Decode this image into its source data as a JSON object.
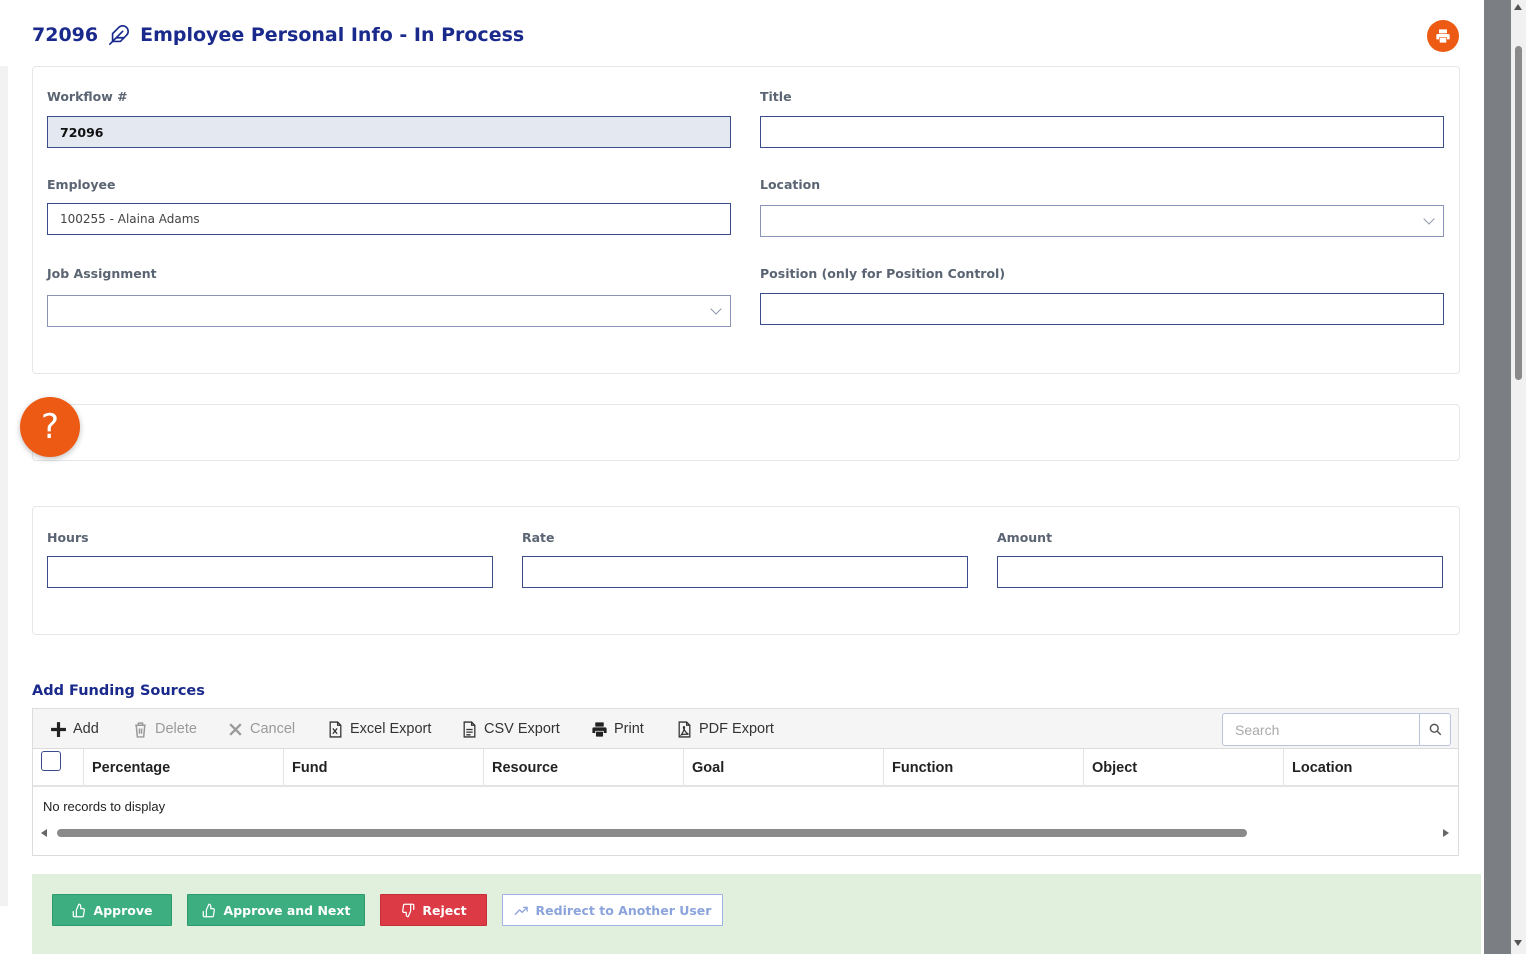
{
  "header": {
    "workflow_number": "72096",
    "title": "Employee Personal Info - In Process"
  },
  "form": {
    "workflow_label": "Workflow #",
    "workflow_value": "72096",
    "title_label": "Title",
    "title_value": "",
    "employee_label": "Employee",
    "employee_value": "100255 - Alaina Adams",
    "location_label": "Location",
    "location_value": "",
    "job_assignment_label": "Job Assignment",
    "job_assignment_value": "",
    "position_label": "Position (only for Position Control)",
    "position_value": ""
  },
  "pay": {
    "hours_label": "Hours",
    "rate_label": "Rate",
    "amount_label": "Amount",
    "hours_value": "",
    "rate_value": "",
    "amount_value": ""
  },
  "help": {
    "glyph": "?"
  },
  "funding": {
    "section_title": "Add Funding Sources",
    "toolbar": {
      "add": "Add",
      "delete": "Delete",
      "cancel": "Cancel",
      "excel": "Excel Export",
      "csv": "CSV Export",
      "print": "Print",
      "pdf": "PDF Export"
    },
    "search_placeholder": "Search",
    "columns": [
      "Percentage",
      "Fund",
      "Resource",
      "Goal",
      "Function",
      "Object",
      "Location"
    ],
    "empty_message": "No records to display"
  },
  "actions": {
    "approve": "Approve",
    "approve_next": "Approve and Next",
    "reject": "Reject",
    "redirect": "Redirect to Another User"
  },
  "colors": {
    "accent_orange": "#ec5a14",
    "title_blue": "#1a2a8c",
    "approve_green": "#3cae80",
    "reject_red": "#dc3b45",
    "action_bar_bg": "#e1f0dc"
  }
}
